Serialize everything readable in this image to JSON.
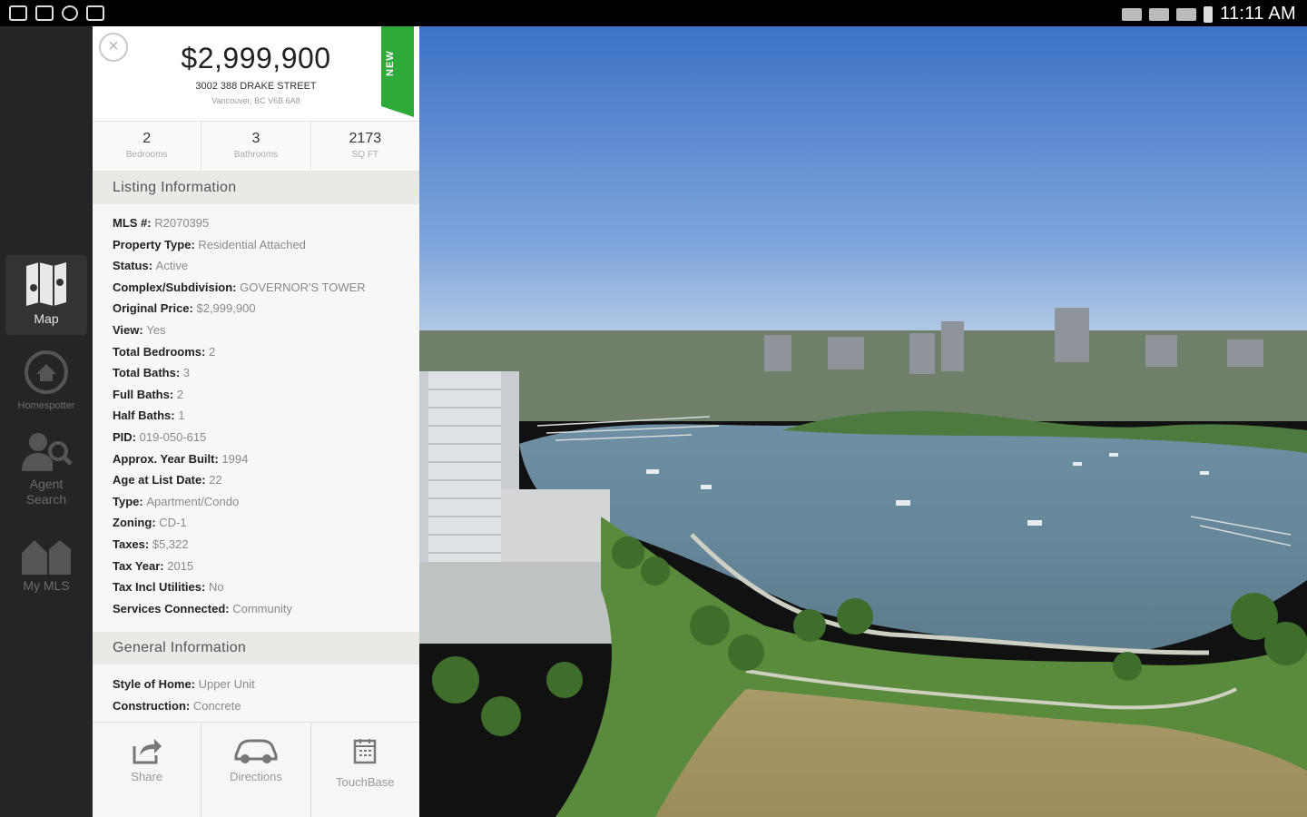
{
  "status_bar": {
    "time": "11:11 AM"
  },
  "nav": {
    "items": [
      {
        "label": "Map",
        "icon": "map-icon",
        "active": true
      },
      {
        "label": "Homespotter",
        "icon": "homespotter-icon",
        "active": false
      },
      {
        "label": "Agent\nSearch",
        "icon": "agent-search-icon",
        "active": false
      },
      {
        "label": "My MLS",
        "icon": "my-mls-icon",
        "active": false
      }
    ]
  },
  "listing": {
    "price": "$2,999,900",
    "address_line1": "3002 388 DRAKE STREET",
    "address_line2": "Vancouver, BC V6B 6A8",
    "badge": "NEW",
    "stats": [
      {
        "value": "2",
        "label": "Bedrooms"
      },
      {
        "value": "3",
        "label": "Bathrooms"
      },
      {
        "value": "2173",
        "label": "SQ FT"
      }
    ],
    "listing_info_title": "Listing Information",
    "listing_info": [
      {
        "key": "MLS #:",
        "value": "R2070395"
      },
      {
        "key": "Property Type:",
        "value": "Residential Attached"
      },
      {
        "key": "Status:",
        "value": "Active"
      },
      {
        "key": "Complex/Subdivision:",
        "value": "GOVERNOR'S TOWER"
      },
      {
        "key": "Original Price:",
        "value": "$2,999,900"
      },
      {
        "key": "View:",
        "value": "Yes"
      },
      {
        "key": "Total Bedrooms:",
        "value": "2"
      },
      {
        "key": "Total Baths:",
        "value": "3"
      },
      {
        "key": "Full Baths:",
        "value": "2"
      },
      {
        "key": "Half Baths:",
        "value": "1"
      },
      {
        "key": "PID:",
        "value": "019-050-615"
      },
      {
        "key": "Approx. Year Built:",
        "value": "1994"
      },
      {
        "key": "Age at List Date:",
        "value": "22"
      },
      {
        "key": "Type:",
        "value": "Apartment/Condo"
      },
      {
        "key": "Zoning:",
        "value": "CD-1"
      },
      {
        "key": "Taxes:",
        "value": "$5,322"
      },
      {
        "key": "Tax Year:",
        "value": "2015"
      },
      {
        "key": "Tax Incl Utilities:",
        "value": "No"
      },
      {
        "key": "Services Connected:",
        "value": "Community"
      }
    ],
    "general_info_title": "General Information",
    "general_info": [
      {
        "key": "Style of Home:",
        "value": "Upper Unit"
      },
      {
        "key": "Construction:",
        "value": "Concrete"
      }
    ]
  },
  "actions": [
    {
      "label": "Share",
      "icon": "share-icon"
    },
    {
      "label": "Directions",
      "icon": "car-icon"
    },
    {
      "label": "TouchBase",
      "icon": "calendar-icon"
    }
  ],
  "colors": {
    "badge": "#2faa3a",
    "nav_bg": "#252525",
    "panel_bg": "#f7f7f5"
  }
}
